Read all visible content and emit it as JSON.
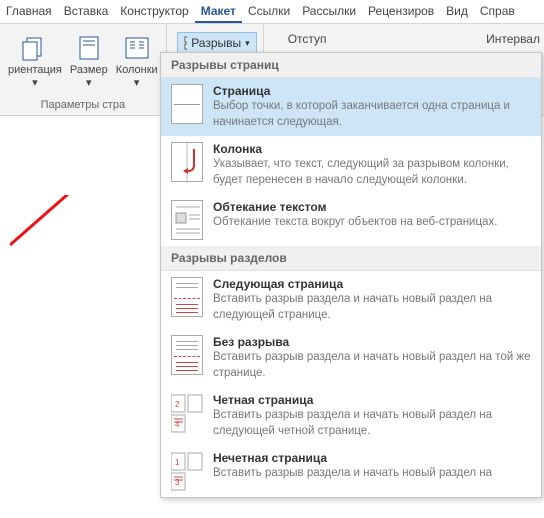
{
  "tabs": {
    "home": "Главная",
    "insert": "Вставка",
    "design": "Конструктор",
    "layout": "Макет",
    "references": "Ссылки",
    "mailings": "Рассылки",
    "review": "Рецензиров",
    "view": "Вид",
    "help": "Справ"
  },
  "ribbon": {
    "orientation": "риентация",
    "size": "Размер",
    "columns": "Колонки",
    "group_page_setup": "Параметры стра",
    "breaks": "Разрывы",
    "indent": "Отступ",
    "interval": "Интервал"
  },
  "dropdown": {
    "section_page_breaks": "Разрывы страниц",
    "section_section_breaks": "Разрывы разделов",
    "page": {
      "title": "Страница",
      "desc": "Выбор точки, в которой заканчивается одна страница и начинается следующая."
    },
    "column": {
      "title": "Колонка",
      "desc": "Указывает, что текст, следующий за разрывом колонки, будет перенесен в начало следующей колонки."
    },
    "wrap": {
      "title": "Обтекание текстом",
      "desc": "Обтекание текста вокруг объектов на веб-страницах."
    },
    "next_page": {
      "title": "Следующая страница",
      "desc": "Вставить разрыв раздела и начать новый раздел на следующей странице."
    },
    "continuous": {
      "title": "Без разрыва",
      "desc": "Вставить разрыв раздела и начать новый раздел на той же странице."
    },
    "even_page": {
      "title": "Четная страница",
      "desc": "Вставить разрыв раздела и начать новый раздел на следующей четной странице."
    },
    "odd_page": {
      "title": "Нечетная страница",
      "desc": "Вставить разрыв раздела и начать новый раздел на"
    }
  }
}
